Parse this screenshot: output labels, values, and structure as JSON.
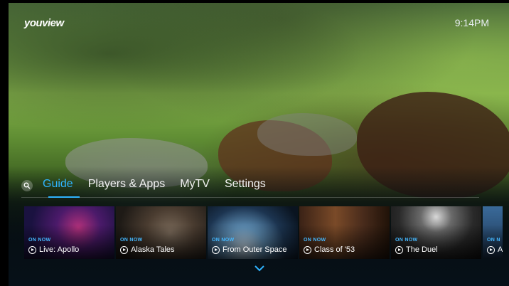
{
  "header": {
    "logo": "youview",
    "time": "9:14PM"
  },
  "nav": {
    "items": [
      {
        "label": "Guide",
        "active": true
      },
      {
        "label": "Players & Apps"
      },
      {
        "label": "MyTV"
      },
      {
        "label": "Settings"
      }
    ]
  },
  "rail": {
    "tiles": [
      {
        "badge": "ON NOW",
        "title": "Live: Apollo"
      },
      {
        "badge": "ON NOW",
        "title": "Alaska Tales"
      },
      {
        "badge": "ON NOW",
        "title": "From Outer Space"
      },
      {
        "badge": "ON NOW",
        "title": "Class of '53"
      },
      {
        "badge": "ON NOW",
        "title": "The Duel"
      },
      {
        "badge": "ON N",
        "title": "A"
      }
    ]
  },
  "colors": {
    "accent": "#2fb4ff",
    "badge": "#45b8ff"
  }
}
